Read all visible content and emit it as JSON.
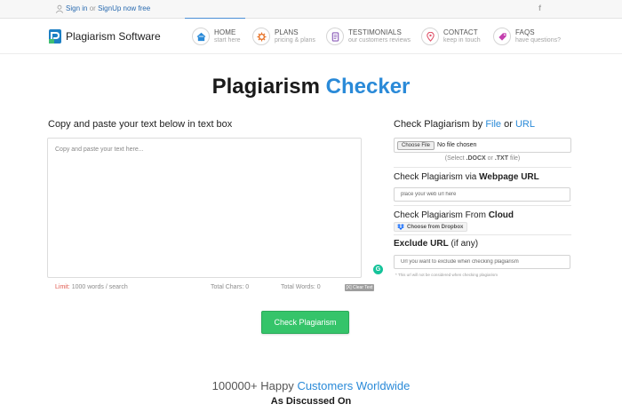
{
  "topbar": {
    "signin": "Sign in",
    "or": "or",
    "signup": "SignUp now free",
    "social": "f"
  },
  "logo": {
    "word1": "Plagiarism",
    "word2": "Software"
  },
  "nav": {
    "items": [
      {
        "label": "HOME",
        "sub": "start here",
        "icon": "home-icon",
        "color": "#2a8ad8"
      },
      {
        "label": "PLANS",
        "sub": "pricing & plans",
        "icon": "gear-icon",
        "color": "#e8772e"
      },
      {
        "label": "TESTIMONIALS",
        "sub": "our customers reviews",
        "icon": "document-icon",
        "color": "#8a5bb8"
      },
      {
        "label": "CONTACT",
        "sub": "keep in touch",
        "icon": "location-pin-icon",
        "color": "#e0536a"
      },
      {
        "label": "FAQS",
        "sub": "have questions?",
        "icon": "tag-icon",
        "color": "#c43fae"
      }
    ]
  },
  "title": {
    "main": "Plagiarism",
    "accent": "Checker"
  },
  "left": {
    "heading": "Copy and paste your text below in text box",
    "textbox_placeholder": "Copy and paste your text here...",
    "limit_label": "Limit:",
    "limit_value": "1000 words / search",
    "total_chars": "Total Chars: 0",
    "total_words": "Total Words: 0",
    "clear_label": "[X] Clear Text"
  },
  "right": {
    "file_heading_pre": "Check Plagiarism by",
    "file_word": "File",
    "or_word": "or",
    "url_word": "URL",
    "choose_file": "Choose File",
    "no_file": "No file chosen",
    "hint_pre": "(Select",
    "hint_docx": ".DOCX",
    "hint_or": "or",
    "hint_txt": ".TXT",
    "hint_post": "file)",
    "webpage_pre": "Check Plagiarism via",
    "webpage_bold": "Webpage URL",
    "webpage_placeholder": "place your web url here",
    "cloud_pre": "Check Plagiarism From",
    "cloud_bold": "Cloud",
    "dropbox_label": "Choose from Dropbox",
    "exclude_bold": "Exclude URL",
    "exclude_post": "(if any)",
    "exclude_placeholder": "Url you want to exclude when checking plagiarism",
    "exclude_note": "* This url will not be considered when checking plagiarism"
  },
  "check_button": "Check Plagiarism",
  "footer": {
    "customers_pre": "100000+ Happy",
    "customers_accent": "Customers Worldwide",
    "discussed": "As Discussed On"
  },
  "colors": {
    "accent": "#2a8ad8",
    "button_green": "#35c46a",
    "limit_red": "#e05a4f"
  }
}
